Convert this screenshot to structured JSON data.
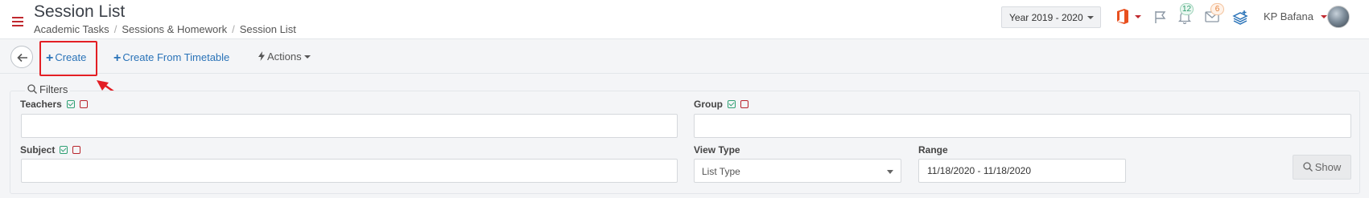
{
  "header": {
    "title": "Session List",
    "breadcrumb": [
      "Academic Tasks",
      "Sessions & Homework",
      "Session List"
    ],
    "year_select": "Year 2019 - 2020",
    "notifications_count": "12",
    "messages_count": "6",
    "user_name": "KP Bafana"
  },
  "toolbar": {
    "create_label": "Create",
    "create_from_timetable_label": "Create From Timetable",
    "actions_label": "Actions"
  },
  "filters": {
    "title": "Filters",
    "teachers_label": "Teachers",
    "teachers_value": "",
    "group_label": "Group",
    "group_value": "",
    "subject_label": "Subject",
    "subject_value": "",
    "view_type_label": "View Type",
    "view_type_value": "List Type",
    "range_label": "Range",
    "range_value": "11/18/2020 - 11/18/2020",
    "show_label": "Show"
  },
  "colors": {
    "accent": "#2a73b8",
    "brand_red": "#c0282e",
    "annotation_red": "#e31e24"
  }
}
